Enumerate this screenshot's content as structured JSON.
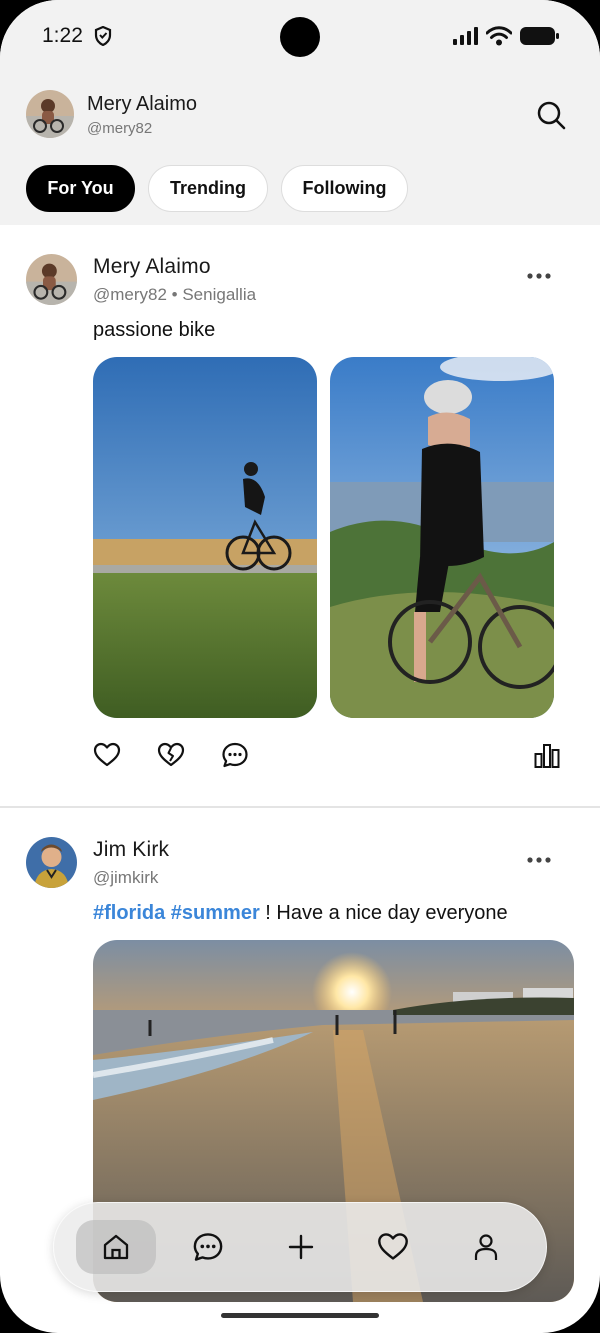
{
  "status_bar": {
    "time": "1:22"
  },
  "header": {
    "user_name": "Mery Alaimo",
    "user_handle": "@mery82",
    "tabs": [
      {
        "label": "For You",
        "active": true
      },
      {
        "label": "Trending",
        "active": false
      },
      {
        "label": "Following",
        "active": false
      }
    ]
  },
  "posts": [
    {
      "author": "Mery Alaimo",
      "handle_location": "@mery82 • Senigallia",
      "text": "passione bike",
      "images": [
        "cyclist-riding-road-photo",
        "cyclist-mountain-view-photo"
      ]
    },
    {
      "author": "Jim Kirk",
      "handle_location": "@jimkirk",
      "hashtags": "#florida #summer",
      "text": "! Have a nice day everyone",
      "images": [
        "florida-beach-sunset-photo"
      ]
    }
  ],
  "bottom_nav": {
    "items": [
      "home-icon",
      "chat-icon",
      "plus-icon",
      "heart-icon",
      "user-icon"
    ],
    "active": "home-icon"
  },
  "colors": {
    "accent": "#000000",
    "hashtag": "#3b86d9",
    "background": "#f2f2f2"
  }
}
